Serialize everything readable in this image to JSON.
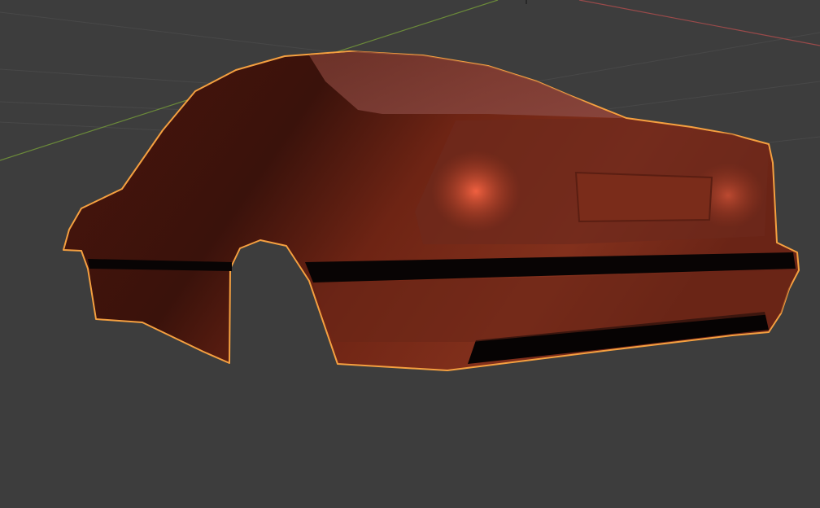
{
  "viewport": {
    "background": "#3d3d3d",
    "grid_color": "#4a4a4a",
    "x_axis_color": "#9a4a4a",
    "y_axis_color": "#6b8a3a",
    "selection_outline_color": "#f5a040",
    "object_color": "#7a2a18",
    "selected_object": "car-body-mesh"
  }
}
